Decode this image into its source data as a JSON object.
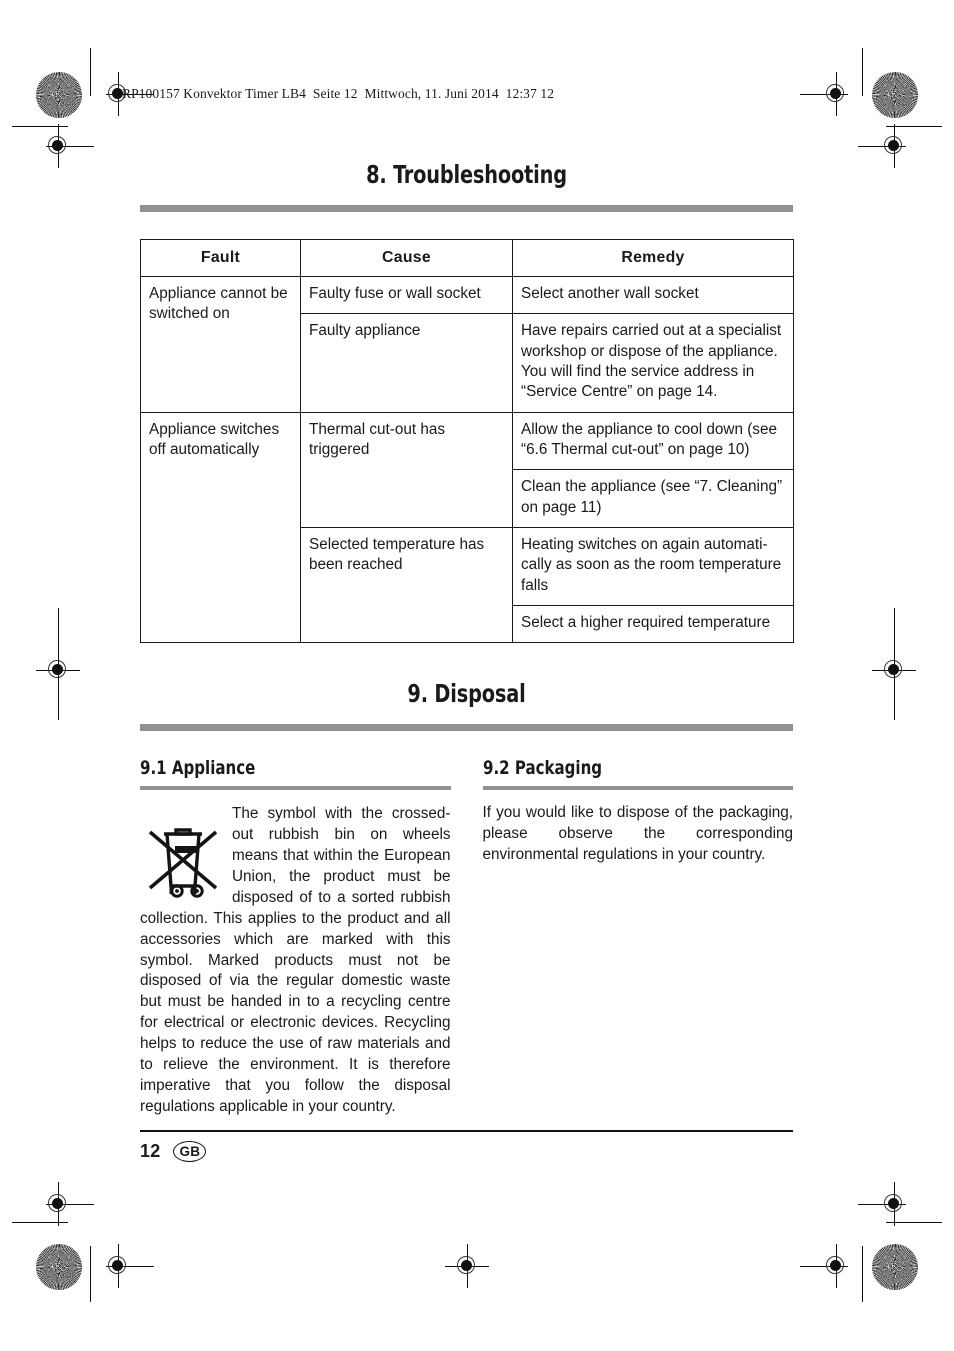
{
  "header": {
    "running_head": "RP100157 Konvektor Timer LB4  Seite 12  Mittwoch, 11. Juni 2014  12:37 12"
  },
  "sections": {
    "troubleshooting": {
      "title": "8. Troubleshooting",
      "table": {
        "columns": [
          "Fault",
          "Cause",
          "Remedy"
        ],
        "rows": [
          {
            "fault": "Appliance cannot be switched on",
            "fault_rowspan": 2,
            "cause": "Faulty fuse or wall socket",
            "remedy": "Select another wall socket"
          },
          {
            "cause": "Faulty appliance",
            "remedy": "Have repairs carried out at a specialist workshop or dispose of the appliance. You will find the service address in “Service Centre” on page 14."
          },
          {
            "fault": "Appliance switches off automatically",
            "fault_rowspan": 4,
            "cause": "Thermal cut-out has triggered",
            "cause_rowspan": 2,
            "remedy": "Allow the appliance to cool down (see “6.6 Thermal cut-out” on page 10)"
          },
          {
            "remedy": "Clean the appliance (see “7. Cleaning” on page 11)"
          },
          {
            "cause": "Selected temperature has been reached",
            "cause_rowspan": 2,
            "remedy": "Heating switches on again automati-cally as soon as the room temperature falls"
          },
          {
            "remedy": "Select a higher required temperature"
          }
        ]
      }
    },
    "disposal": {
      "title": "9. Disposal",
      "appliance": {
        "title": "9.1 Appliance",
        "icon": "crossed-out-wheelie-bin-icon",
        "body": "The symbol with the crossed-out rubbish bin on wheels means that within the European Union, the product must be disposed of to a sorted rubbish collection. This applies to the product and all accessories which are marked with this symbol. Marked products must not be disposed of via the regular domestic waste but must be handed in to a recycling centre for electrical or electronic devices. Recycling helps to reduce the use of raw materials and to relieve the environment. It is therefore imperative that you follow the disposal regulations applicable in your country."
      },
      "packaging": {
        "title": "9.2 Packaging",
        "body": "If you would like to dispose of the packaging, please observe the corresponding environmental regulations in your country."
      }
    }
  },
  "footer": {
    "page_number": "12",
    "language_badge": "GB"
  },
  "colors": {
    "rule_gray": "#919191",
    "text": "#1a1a1a",
    "page_background": "#ffffff"
  }
}
